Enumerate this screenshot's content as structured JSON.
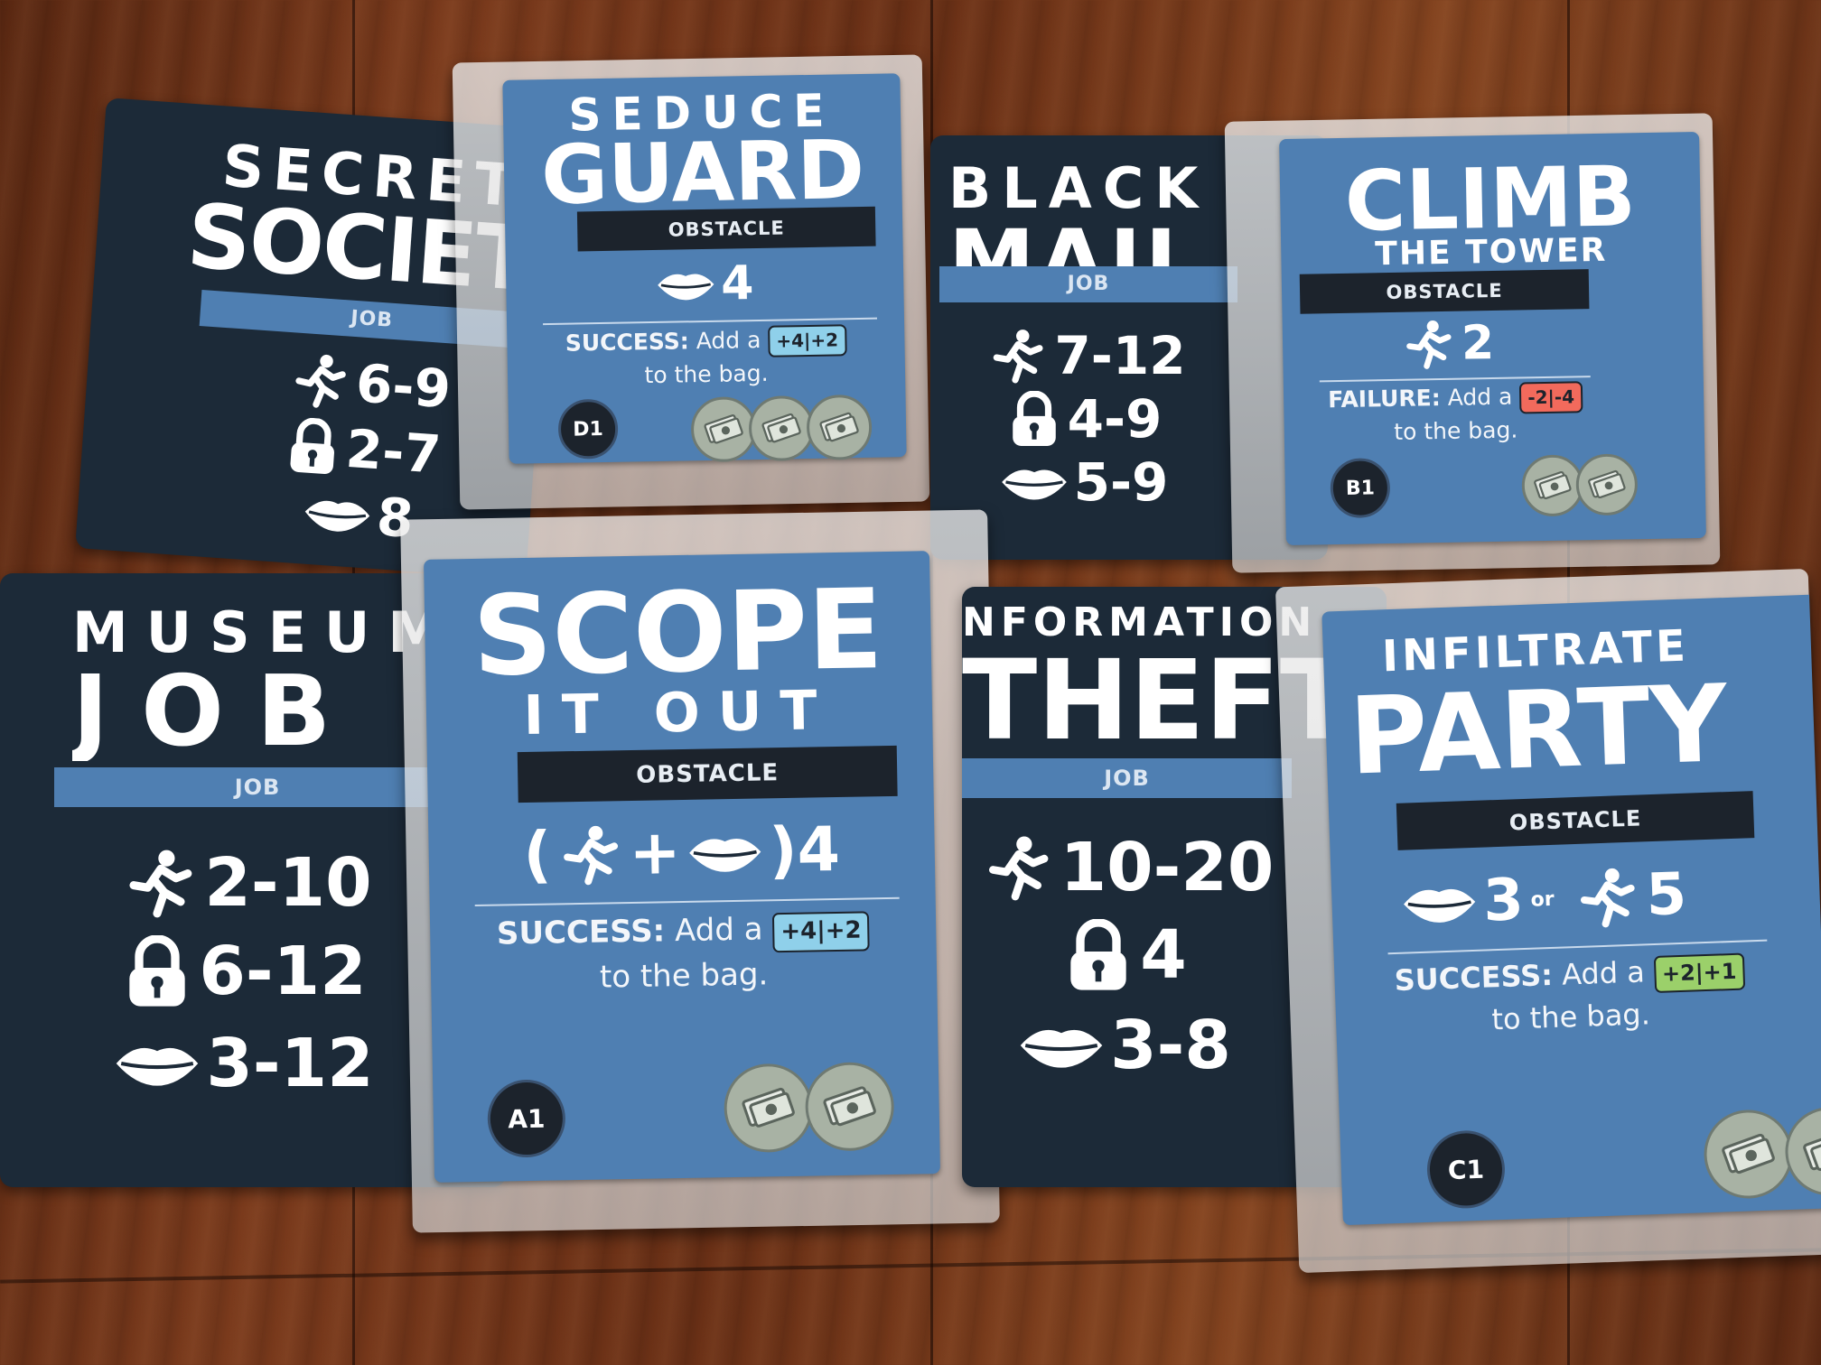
{
  "icons": {
    "skill_run": "running-figure-icon",
    "skill_lock": "padlock-icon",
    "skill_charm": "lips-icon",
    "reward": "cash-coin-icon"
  },
  "colors": {
    "job_card": "#1c2a38",
    "obstacle_card": "#4f7fb2",
    "chip_blue": "#8fd0ea",
    "chip_red": "#f26a5c",
    "chip_green": "#9bd06a"
  },
  "cards": {
    "secret_society": {
      "title_top": "SECRET",
      "title_main": "SOCIETY",
      "type": "JOB",
      "stats": {
        "run": "6-9",
        "lock": "2-7",
        "charm": "8"
      }
    },
    "seduce_guard": {
      "title_top": "SEDUCE",
      "title_main": "GUARD",
      "type": "OBSTACLE",
      "requirement": "4",
      "effect_label": "SUCCESS:",
      "effect_text": "Add a",
      "chip": "+4|+2",
      "effect_tail": "to the bag.",
      "code": "D1"
    },
    "black_mail": {
      "title_top": "BLACK",
      "title_main": "MAIL",
      "type": "JOB",
      "stats": {
        "run": "7-12",
        "lock": "4-9",
        "charm": "5-9"
      }
    },
    "climb_tower": {
      "title_main": "CLIMB",
      "title_sub": "THE TOWER",
      "type": "OBSTACLE",
      "requirement": "2",
      "effect_label": "FAILURE:",
      "effect_text": "Add a",
      "chip": "-2|-4",
      "effect_tail": "to the bag.",
      "code": "B1"
    },
    "museum_job": {
      "title_top": "MUSEUM",
      "title_main": "JOB",
      "type": "JOB",
      "stats": {
        "run": "2-10",
        "lock": "6-12",
        "charm": "3-12"
      }
    },
    "scope_it_out": {
      "title_main": "SCOPE",
      "title_sub": "IT OUT",
      "type": "OBSTACLE",
      "req_open": "(",
      "req_plus": "+",
      "req_close": ")4",
      "effect_label": "SUCCESS:",
      "effect_text": "Add a",
      "chip": "+4|+2",
      "effect_tail": "to the bag.",
      "code": "A1"
    },
    "information_theft": {
      "title_top": "NFORMATION",
      "title_main": "THEFT",
      "type": "JOB",
      "stats": {
        "run": "10-20",
        "lock": "4",
        "charm": "3-8"
      }
    },
    "infiltrate_party": {
      "title_top": "INFILTRATE",
      "title_main": "PARTY",
      "type": "OBSTACLE",
      "req_a": "3",
      "req_or": "or",
      "req_b": "5",
      "effect_label": "SUCCESS:",
      "effect_text": "Add a",
      "chip": "+2|+1",
      "effect_tail": "to the bag.",
      "code": "C1"
    }
  }
}
